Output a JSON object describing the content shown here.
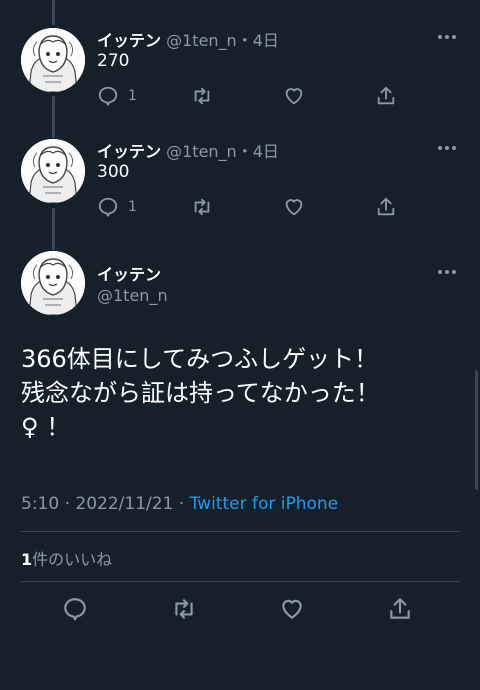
{
  "tweets": [
    {
      "name": "イッテン",
      "handle": "@1ten_n",
      "time": "・4日",
      "text": "270",
      "reply_count": "1"
    },
    {
      "name": "イッテン",
      "handle": "@1ten_n",
      "time": "・4日",
      "text": "300",
      "reply_count": "1"
    }
  ],
  "main_tweet": {
    "name": "イッテン",
    "handle": "@1ten_n",
    "lines": [
      "366体目にしてみつふしゲット！",
      "残念ながら証は持ってなかった！",
      "♀ ！"
    ],
    "timestamp": "5:10 · 2022/11/21 · ",
    "source": "Twitter for iPhone",
    "like_count": "1",
    "like_label": "件のいいね"
  },
  "icons": [
    "more-icon",
    "reply-icon",
    "retweet-icon",
    "like-icon",
    "share-icon"
  ],
  "colors": {
    "background": "#15202b",
    "text": "#ffffff",
    "secondary": "#8b98a5",
    "link": "#1d9bf0",
    "divider": "#38444d"
  }
}
